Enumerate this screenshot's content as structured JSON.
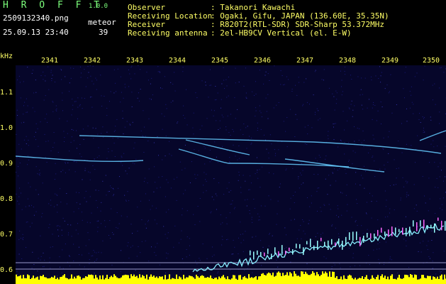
{
  "header": {
    "app_title": "H R O F F T",
    "version": "1.0.0",
    "filename": "2509132340.png",
    "meteor_label": "meteor",
    "datetime": "25.09.13 23:40",
    "meteor_count": "39",
    "info": [
      {
        "label": "Observer",
        "value": ": Takanori Kawachi"
      },
      {
        "label": "Receiving Location",
        "value": ": Ogaki, Gifu, JAPAN (136.60E, 35.35N)"
      },
      {
        "label": "Receiver",
        "value": ": R820T2(RTL-SDR) SDR-Sharp 53.372MHz"
      },
      {
        "label": "Receiving antenna",
        "value": ": 2el-HB9CV Vertical (el. E-W)"
      }
    ]
  },
  "axes": {
    "y_unit": "kHz",
    "x_ticks": [
      "2341",
      "2342",
      "2343",
      "2344",
      "2345",
      "2346",
      "2347",
      "2348",
      "2349",
      "2350"
    ],
    "y_ticks": [
      "1.1",
      "1.0",
      "0.9",
      "0.8",
      "0.7",
      "0.6"
    ]
  },
  "colors": {
    "background": "#06062a",
    "label": "#ffff66",
    "trace": "#66ffff",
    "noise_bar": "#ffff00"
  }
}
